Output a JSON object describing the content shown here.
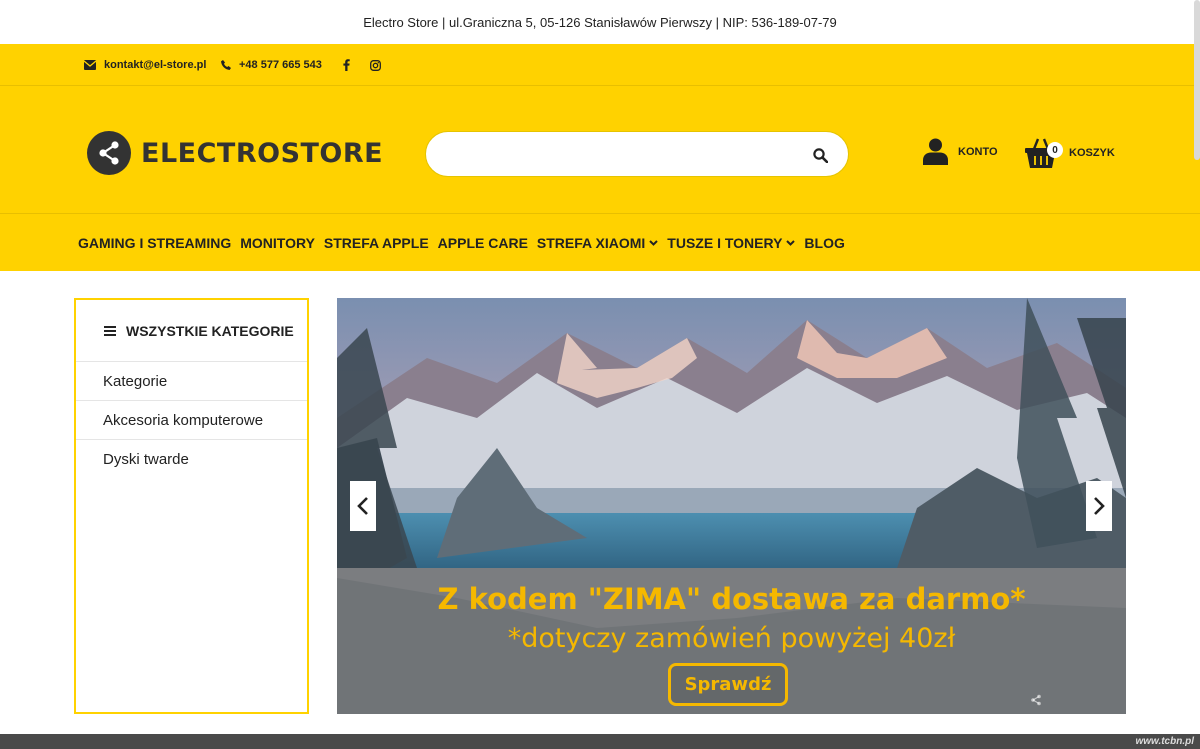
{
  "topbar": {
    "text": "Electro Store | ul.Graniczna 5, 05-126 Stanisławów Pierwszy | NIP: 536-189-07-79"
  },
  "contact": {
    "email": "kontakt@el-store.pl",
    "phone": "+48 577 665 543",
    "icons": [
      "envelope-icon",
      "phone-icon",
      "facebook-icon",
      "instagram-icon"
    ]
  },
  "header": {
    "logo_text": "ELECTROSTORE",
    "search_placeholder": "",
    "account_label": "KONTO",
    "cart_label": "KOSZYK",
    "cart_count": "0"
  },
  "nav": {
    "items": [
      {
        "label": "GAMING I STREAMING",
        "dropdown": false
      },
      {
        "label": "MONITORY",
        "dropdown": false
      },
      {
        "label": "STREFA APPLE",
        "dropdown": false
      },
      {
        "label": "APPLE CARE",
        "dropdown": false
      },
      {
        "label": "STREFA XIAOMI",
        "dropdown": true
      },
      {
        "label": "TUSZE I TONERY",
        "dropdown": true
      },
      {
        "label": "BLOG",
        "dropdown": false
      }
    ]
  },
  "sidebar": {
    "title": "WSZYSTKIE KATEGORIE",
    "items": [
      "Kategorie",
      "Akcesoria komputerowe",
      "Dyski twarde"
    ]
  },
  "slider": {
    "title": "Z kodem \"ZIMA\" dostawa za darmo*",
    "subtitle": "*dotyczy zamówień powyżej 40zł",
    "button": "Sprawdź"
  },
  "footer": {
    "credit": "www.tcbn.pl"
  },
  "colors": {
    "accent": "#ffd200",
    "caption_text": "#f5b800",
    "dark": "#333333"
  }
}
